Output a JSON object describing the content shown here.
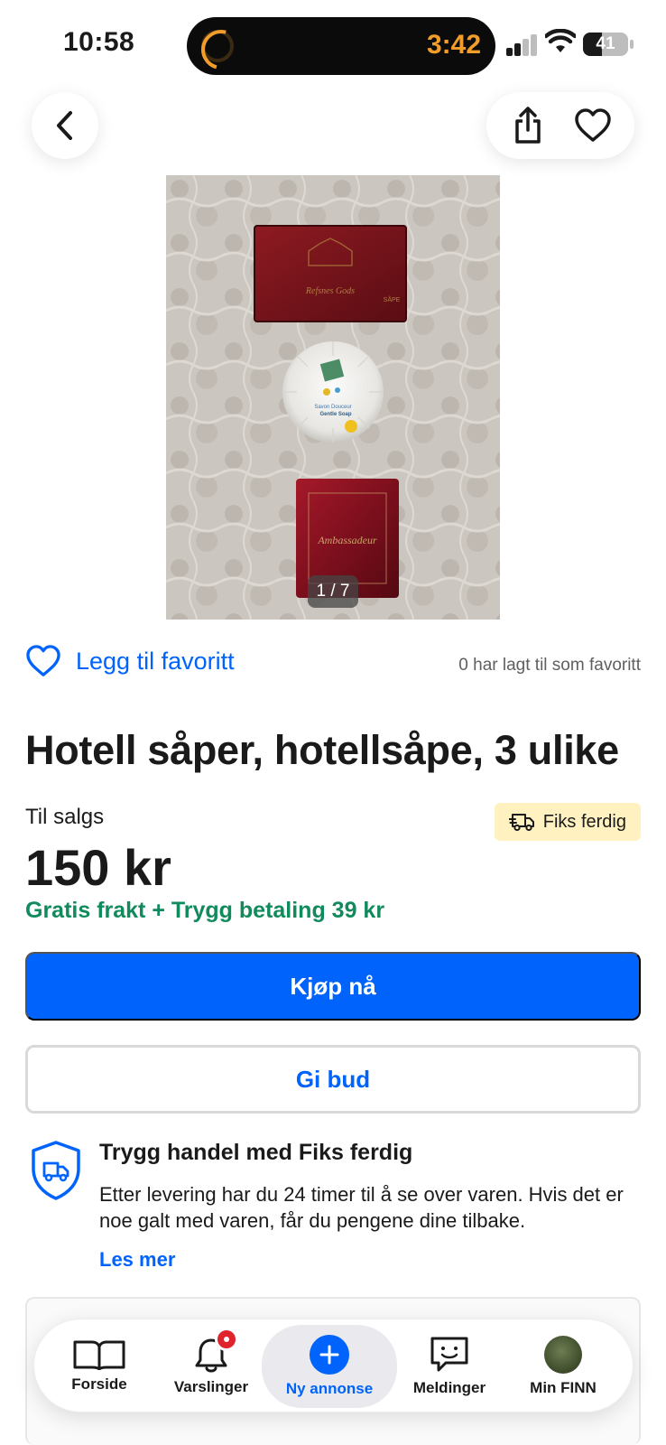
{
  "status_bar": {
    "time": "10:58",
    "timer": "3:42",
    "battery": "41",
    "battery_level": 0.41
  },
  "top_nav": {
    "back_icon": "chevron-left-icon",
    "share_icon": "share-icon",
    "favorite_icon": "heart-outline-icon"
  },
  "gallery": {
    "counter": "1 / 7"
  },
  "favorite": {
    "label": "Legg til favoritt",
    "count_text": "0 har lagt til som favoritt"
  },
  "listing": {
    "title": "Hotell såper, hotellsåpe, 3 ulike",
    "sale_type": "Til salgs",
    "badge": "Fiks ferdig",
    "price": "150 kr",
    "shipping": "Gratis frakt + Trygg betaling 39 kr"
  },
  "actions": {
    "buy": "Kjøp nå",
    "bid": "Gi bud"
  },
  "safe_trade": {
    "title": "Trygg handel med Fiks ferdig",
    "body": "Etter levering har du 24 timer til å se over varen. Hvis det er noe galt med varen, får du pengene dine tilbake.",
    "link": "Les mer"
  },
  "tabbar": {
    "items": [
      {
        "label": "Forside",
        "icon": "book-icon"
      },
      {
        "label": "Varslinger",
        "icon": "bell-icon"
      },
      {
        "label": "Ny annonse",
        "icon": "plus-icon"
      },
      {
        "label": "Meldinger",
        "icon": "chat-icon"
      },
      {
        "label": "Min FINN",
        "icon": "avatar"
      }
    ]
  },
  "colors": {
    "accent": "#0063fb",
    "success": "#118a5c",
    "badge_bg": "#fff2c0",
    "notification": "#e0242e"
  }
}
